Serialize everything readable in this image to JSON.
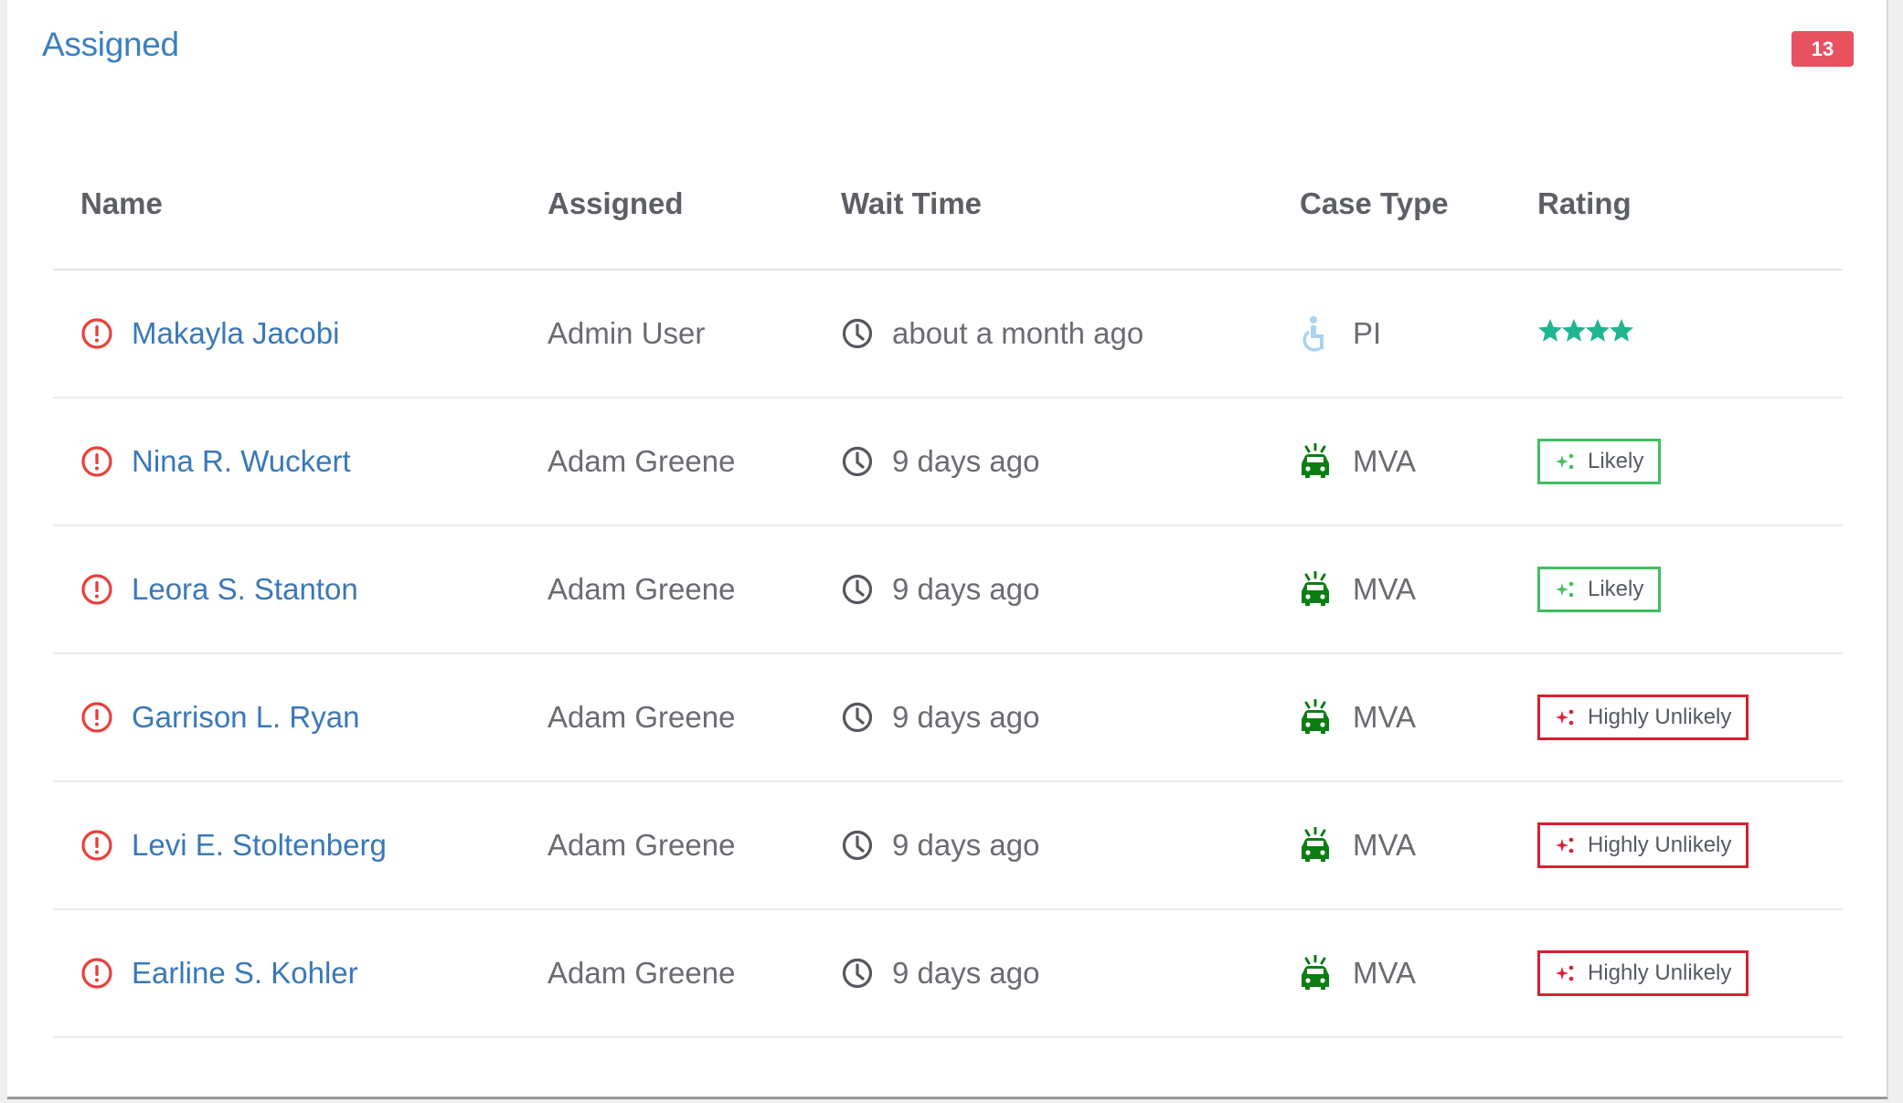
{
  "card": {
    "title": "Assigned",
    "count_badge": "13"
  },
  "colors": {
    "title": "#3a7fc1",
    "badge_bg": "#e8515f",
    "alert": "#e8403c",
    "star": "#1fb58f",
    "likely": "#3fbf5f",
    "unlikely": "#d9202f",
    "mva_icon": "#0b7d12",
    "pi_icon": "#a9d3ee"
  },
  "table": {
    "headers": {
      "name": "Name",
      "assigned": "Assigned",
      "wait_time": "Wait Time",
      "case_type": "Case Type",
      "rating": "Rating"
    },
    "rows": [
      {
        "name": "Makayla Jacobi",
        "assigned": "Admin User",
        "wait_time": "about a month ago",
        "case_type": "PI",
        "case_icon": "wheelchair-icon",
        "rating_type": "stars",
        "stars": 4,
        "rating_label": ""
      },
      {
        "name": "Nina R. Wuckert",
        "assigned": "Adam Greene",
        "wait_time": "9 days ago",
        "case_type": "MVA",
        "case_icon": "car-crash-icon",
        "rating_type": "likely",
        "rating_label": "Likely"
      },
      {
        "name": "Leora S. Stanton",
        "assigned": "Adam Greene",
        "wait_time": "9 days ago",
        "case_type": "MVA",
        "case_icon": "car-crash-icon",
        "rating_type": "likely",
        "rating_label": "Likely"
      },
      {
        "name": "Garrison L. Ryan",
        "assigned": "Adam Greene",
        "wait_time": "9 days ago",
        "case_type": "MVA",
        "case_icon": "car-crash-icon",
        "rating_type": "unlikely",
        "rating_label": "Highly Unlikely"
      },
      {
        "name": "Levi E. Stoltenberg",
        "assigned": "Adam Greene",
        "wait_time": "9 days ago",
        "case_type": "MVA",
        "case_icon": "car-crash-icon",
        "rating_type": "unlikely",
        "rating_label": "Highly Unlikely"
      },
      {
        "name": "Earline S. Kohler",
        "assigned": "Adam Greene",
        "wait_time": "9 days ago",
        "case_type": "MVA",
        "case_icon": "car-crash-icon",
        "rating_type": "unlikely",
        "rating_label": "Highly Unlikely"
      }
    ]
  }
}
